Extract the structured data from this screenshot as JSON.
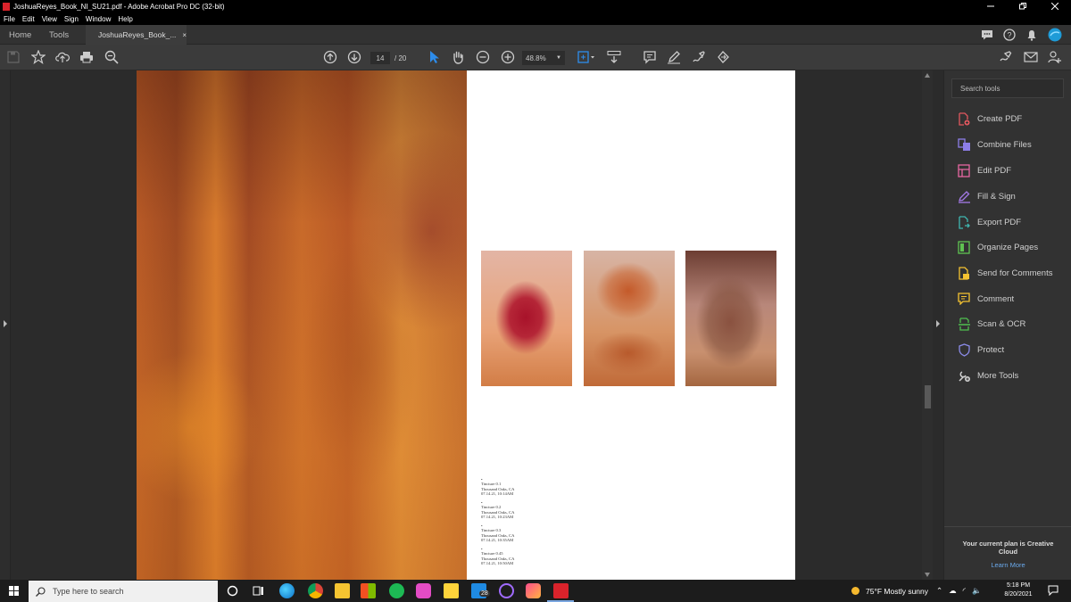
{
  "window": {
    "title": "JoshuaReyes_Book_NI_SU21.pdf - Adobe Acrobat Pro DC (32-bit)"
  },
  "menu": [
    "File",
    "Edit",
    "View",
    "Sign",
    "Window",
    "Help"
  ],
  "tabs": {
    "home": "Home",
    "tools": "Tools",
    "document": "JoshuaReyes_Book_...",
    "close": "×"
  },
  "toolbar": {
    "current_page": "14",
    "total_pages": "/ 20",
    "zoom": "48.8%"
  },
  "document": {
    "captions": [
      {
        "mark": "•",
        "title": "Tincture 0.1",
        "place": "Thousand Oaks, CA",
        "date": "07.14.21, 10:14AM"
      },
      {
        "mark": "•",
        "title": "Tincture 0.2",
        "place": "Thousand Oaks, CA",
        "date": "07.14.21, 10:23AM"
      },
      {
        "mark": "•",
        "title": "Tincture 0.3",
        "place": "Thousand Oaks, CA",
        "date": "07.14.21, 10:35AM"
      },
      {
        "mark": "•",
        "title": "Tincture 0.45",
        "place": "Thousand Oaks, CA",
        "date": "07.14.21, 10:50AM"
      }
    ]
  },
  "tools_panel": {
    "search_placeholder": "Search tools",
    "items": [
      {
        "label": "Create PDF",
        "icon": "create-pdf-icon",
        "color": "#e0575e"
      },
      {
        "label": "Combine Files",
        "icon": "combine-files-icon",
        "color": "#8d7ee8"
      },
      {
        "label": "Edit PDF",
        "icon": "edit-pdf-icon",
        "color": "#e667a2"
      },
      {
        "label": "Fill & Sign",
        "icon": "fill-sign-icon",
        "color": "#a57ae8"
      },
      {
        "label": "Export PDF",
        "icon": "export-pdf-icon",
        "color": "#3fb6b0"
      },
      {
        "label": "Organize Pages",
        "icon": "organize-pages-icon",
        "color": "#5fc251"
      },
      {
        "label": "Send for Comments",
        "icon": "send-comments-icon",
        "color": "#f5c231"
      },
      {
        "label": "Comment",
        "icon": "comment-icon",
        "color": "#f5c231"
      },
      {
        "label": "Scan & OCR",
        "icon": "scan-ocr-icon",
        "color": "#4fbf4f"
      },
      {
        "label": "Protect",
        "icon": "protect-icon",
        "color": "#8b8be8"
      },
      {
        "label": "More Tools",
        "icon": "more-tools-icon",
        "color": "#d0d0d0"
      }
    ],
    "plan_text": "Your current plan is Creative Cloud",
    "learn_more": "Learn More"
  },
  "taskbar": {
    "search_placeholder": "Type here to search",
    "mail_badge": "28",
    "weather": "75°F  Mostly sunny",
    "time": "5:18 PM",
    "date": "8/20/2021"
  }
}
